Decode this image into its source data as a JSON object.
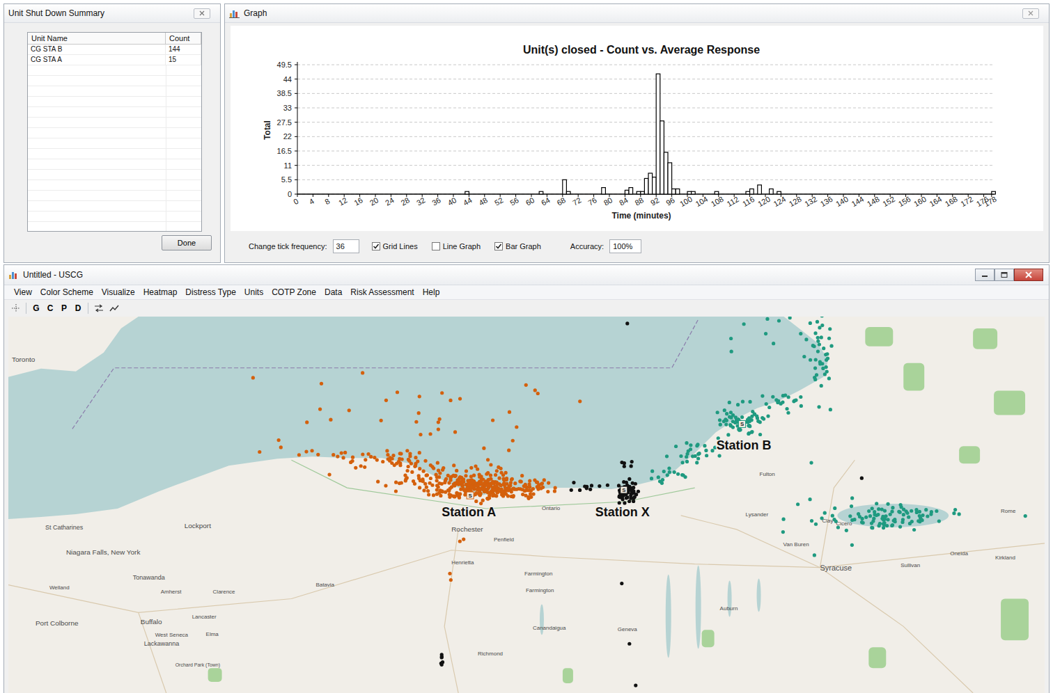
{
  "summary_window": {
    "title": "Unit Shut Down Summary",
    "table": {
      "columns": [
        "Unit Name",
        "Count"
      ],
      "rows": [
        [
          "CG STA B",
          "144"
        ],
        [
          "CG STA A",
          "15"
        ]
      ]
    },
    "button": "Done"
  },
  "graph_window": {
    "title": "Graph",
    "chart": {
      "title": "Unit(s) closed - Count vs. Average Response",
      "y_label": "Total",
      "x_label": "Time (minutes)",
      "y_ticks": [
        "0",
        "5.5",
        "11",
        "16.5",
        "22",
        "27.5",
        "33",
        "38.5",
        "44",
        "49.5"
      ],
      "x_ticks": [
        "0",
        "4",
        "8",
        "12",
        "16",
        "20",
        "24",
        "28",
        "32",
        "36",
        "40",
        "44",
        "48",
        "52",
        "56",
        "60",
        "64",
        "68",
        "72",
        "76",
        "80",
        "84",
        "88",
        "92",
        "96",
        "100",
        "104",
        "108",
        "112",
        "116",
        "120",
        "124",
        "128",
        "132",
        "136",
        "140",
        "144",
        "148",
        "152",
        "156",
        "160",
        "164",
        "168",
        "172",
        "176",
        "178"
      ],
      "series": [
        {
          "values": [
            0,
            0,
            0,
            0,
            0,
            0,
            0,
            0,
            0,
            0,
            0,
            0,
            0,
            0,
            0,
            0,
            0,
            0,
            0,
            0,
            0,
            0,
            0,
            0,
            0,
            0,
            0,
            0,
            0,
            0,
            0,
            0,
            0,
            0,
            0,
            0,
            0,
            0,
            0,
            0,
            0,
            0,
            0,
            1,
            0,
            0,
            0,
            0,
            0,
            0,
            0,
            0,
            0,
            0,
            0,
            0,
            0,
            0,
            0,
            0,
            0,
            0,
            1,
            0,
            0,
            0,
            0,
            0,
            5.5,
            1,
            0,
            0,
            0,
            0,
            0,
            0,
            0,
            0,
            2.5,
            0,
            0,
            0,
            0,
            0,
            1.5,
            2.5,
            0,
            1,
            1,
            6,
            8,
            6.5,
            46,
            28,
            16,
            12,
            2,
            2,
            0,
            0,
            1,
            1,
            0,
            0,
            0,
            0,
            0,
            1,
            0,
            0,
            0,
            0,
            0,
            0,
            0,
            1,
            2,
            0,
            3.5,
            0,
            0,
            2,
            0,
            1,
            0,
            0,
            0,
            0,
            0,
            0,
            0,
            0,
            0,
            0,
            0,
            0,
            0,
            0,
            0,
            0,
            0,
            0,
            0,
            0,
            0,
            0,
            0,
            0,
            0,
            0,
            0,
            0,
            0,
            0,
            0,
            0,
            0,
            0,
            0,
            0,
            0,
            0,
            0,
            0,
            0,
            0,
            0,
            0,
            0,
            0,
            0,
            0,
            0,
            0,
            0,
            0,
            0,
            0,
            1
          ]
        }
      ]
    },
    "controls": {
      "tick_label": "Change tick frequency:",
      "tick_value": "36",
      "checkboxes": [
        {
          "label": "Grid Lines",
          "checked": true
        },
        {
          "label": "Line Graph",
          "checked": false
        },
        {
          "label": "Bar Graph",
          "checked": true
        }
      ],
      "accuracy_label": "Accuracy:",
      "accuracy_value": "100%"
    }
  },
  "main_window": {
    "title": "Untitled - USCG",
    "menu": [
      "View",
      "Color Scheme",
      "Visualize",
      "Heatmap",
      "Distress Type",
      "Units",
      "COTP Zone",
      "Data",
      "Risk Assessment",
      "Help"
    ],
    "toolbar": [
      "G",
      "C",
      "P",
      "D"
    ],
    "map": {
      "marker": "S",
      "stations": [
        {
          "label": "Station A",
          "color": "#d4600c"
        },
        {
          "label": "Station X",
          "color": "#111111"
        },
        {
          "label": "Station B",
          "color": "#1f9a80"
        }
      ],
      "places": [
        "Toronto",
        "St Catharines",
        "Lockport",
        "Niagara Falls, New York",
        "Tonawanda",
        "Welland",
        "Amherst",
        "Clarence",
        "Batavia",
        "Port Colborne",
        "Buffalo",
        "Lancaster",
        "West Seneca",
        "Elma",
        "Lackawanna",
        "Orchard Park (Town)",
        "Rochester",
        "Penfield",
        "Henrietta",
        "Ontario",
        "Farmington",
        "Farmington",
        "Canandaigua",
        "Geneva",
        "Richmond",
        "Auburn",
        "Lysander",
        "Fulton",
        "Clay",
        "Cicero",
        "Van Buren",
        "Syracuse",
        "Sullivan",
        "Oneida",
        "Rome",
        "Kirkland"
      ]
    }
  }
}
